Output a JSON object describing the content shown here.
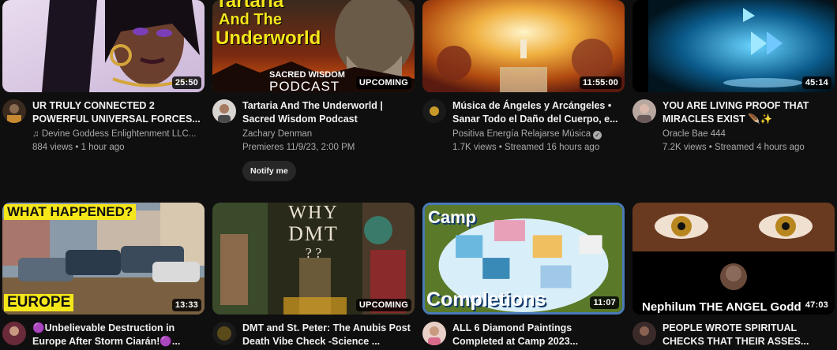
{
  "videos": [
    {
      "title": "UR TRULY CONNECTED 2 POWERFUL UNIVERSAL FORCES...",
      "channel": "Devine Goddess Enlightenment LLC...",
      "channel_icon": "music-note-icon",
      "views": "884 views",
      "age": "1 hour ago",
      "duration": "25:50"
    },
    {
      "title": "Tartaria And The Underworld | Sacred Wisdom Podcast",
      "channel": "Zachary Denman",
      "premiere": "Premieres 11/9/23, 2:00 PM",
      "duration": "UPCOMING",
      "notify_label": "Notify me",
      "thumb_text": [
        "Tartaria",
        "And The",
        "Underworld",
        "SACRED WISDOM",
        "PODCAST"
      ]
    },
    {
      "title": "Música de Ángeles y Arcángeles • Sanar Todo el Daño del Cuerpo, e...",
      "channel": "Positiva Energía Relajarse Música",
      "verified": true,
      "views": "1.7K views",
      "age": "Streamed 16 hours ago",
      "duration": "11:55:00"
    },
    {
      "title": "YOU ARE LIVING PROOF THAT MIRACLES EXIST 🪶✨",
      "channel": "Oracle Bae 444",
      "views": "7.2K views",
      "age": "Streamed 4 hours ago",
      "duration": "45:14"
    },
    {
      "title": "🟣Unbelievable Destruction in Europe After Storm Ciarán!🟣...",
      "duration": "13:33",
      "thumb_text": [
        "WHAT HAPPENED?",
        "EUROPE"
      ]
    },
    {
      "title": "DMT and St. Peter: The Anubis Post Death Vibe Check -Science ...",
      "duration": "UPCOMING",
      "thumb_text": [
        "WHY",
        "DMT",
        "?  ?"
      ]
    },
    {
      "title": "ALL 6 Diamond Paintings Completed at Camp 2023...",
      "duration": "11:07",
      "thumb_text": [
        "Camp",
        "Completions"
      ]
    },
    {
      "title": "PEOPLE WROTE SPIRITUAL CHECKS THAT THEIR ASSES...",
      "duration": "47:03",
      "thumb_text": [
        "Nephilum THE ANGEL Godd"
      ]
    }
  ],
  "colors": {
    "background": "#0f0f0f",
    "text_primary": "#f1f1f1",
    "text_secondary": "#aaaaaa",
    "button_bg": "#272727",
    "thumb_yellow": "#f5e61a"
  }
}
